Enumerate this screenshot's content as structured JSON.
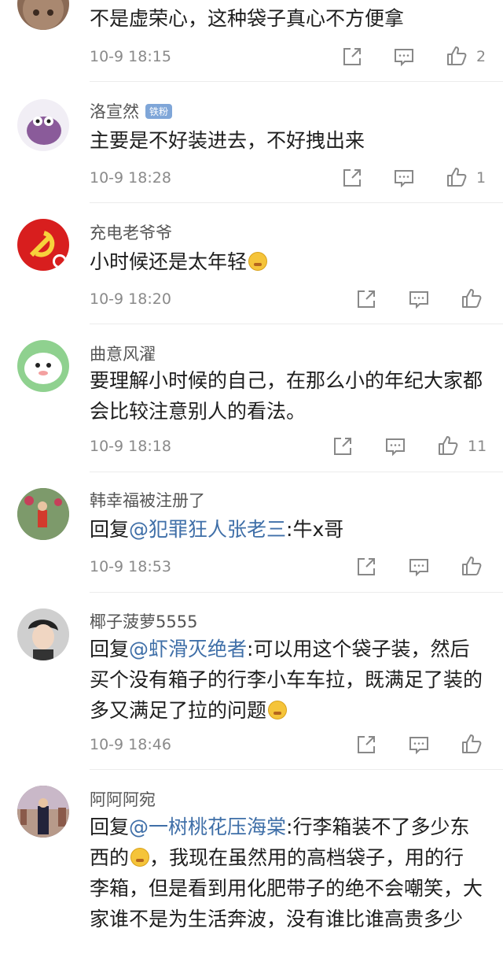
{
  "comments": [
    {
      "name": "",
      "badge": "",
      "text": "不是虚荣心，这种袋子真心不方便拿",
      "time": "10-9 18:15",
      "likes": "2"
    },
    {
      "name": "洛宣然",
      "badge": "铁粉",
      "text": "主要是不好装进去，不好拽出来",
      "time": "10-9 18:28",
      "likes": "1"
    },
    {
      "name": "充电老爷爷",
      "badge": "",
      "text": "小时候还是太年轻",
      "time": "10-9 18:20",
      "likes": ""
    },
    {
      "name": "曲意风濯",
      "badge": "",
      "text": "要理解小时候的自己，在那么小的年纪大家都会比较注意别人的看法。",
      "time": "10-9 18:18",
      "likes": "11"
    },
    {
      "name": "韩幸福被注册了",
      "badge": "",
      "reply_prefix": "回复",
      "mention": "@犯罪狂人张老三",
      "text": ":牛x哥",
      "time": "10-9 18:53",
      "likes": ""
    },
    {
      "name": "椰子菠萝5555",
      "badge": "",
      "reply_prefix": "回复",
      "mention": "@虾滑灭绝者",
      "text": ":可以用这个袋子装，然后买个没有箱子的行李小车车拉，既满足了装的多又满足了拉的问题",
      "time": "10-9 18:46",
      "likes": ""
    },
    {
      "name": "阿阿阿宛",
      "badge": "",
      "reply_prefix": "回复",
      "mention": "@一树桃花压海棠",
      "text": ":行李箱装不了多少东西的",
      "text2": "，我现在虽然用的高档袋子，用的行李箱，但是看到用化肥带子的绝不会嘲笑，大家谁不是为生活奔波，没有谁比谁高贵多少",
      "time": "",
      "likes": ""
    }
  ]
}
